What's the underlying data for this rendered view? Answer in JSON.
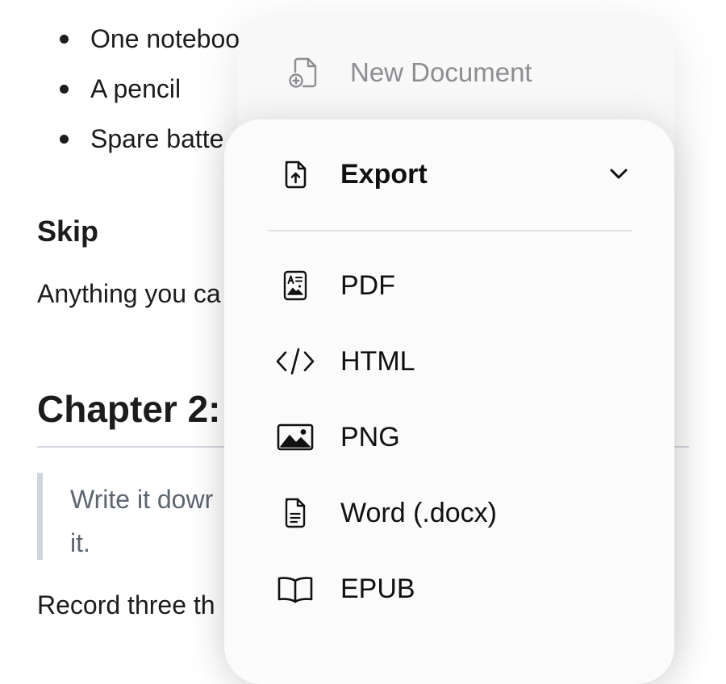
{
  "document": {
    "bullets": [
      "One noteboo",
      "A pencil",
      "Spare batte"
    ],
    "heading_skip": "Skip",
    "paragraph_anything": "Anything you ca",
    "heading_chapter": "Chapter 2:",
    "quote_lines": [
      "Write it dowr",
      "it."
    ],
    "paragraph_record": "Record three th"
  },
  "menu": {
    "back_item": {
      "label": "New Document",
      "icon": "new-document-icon"
    },
    "export": {
      "label": "Export",
      "icon": "export-file-icon",
      "chevron_icon": "chevron-down-icon"
    },
    "items": [
      {
        "label": "PDF",
        "icon": "pdf-file-icon"
      },
      {
        "label": "HTML",
        "icon": "code-icon"
      },
      {
        "label": "PNG",
        "icon": "image-icon"
      },
      {
        "label": "Word (.docx)",
        "icon": "document-icon"
      },
      {
        "label": "EPUB",
        "icon": "book-icon"
      }
    ]
  },
  "colors": {
    "text": "#1c1c1e",
    "muted_text": "#8d8d92",
    "quote_text": "#5d6570",
    "menu_background": "#fbfbfb",
    "divider": "#e2e2e4"
  }
}
